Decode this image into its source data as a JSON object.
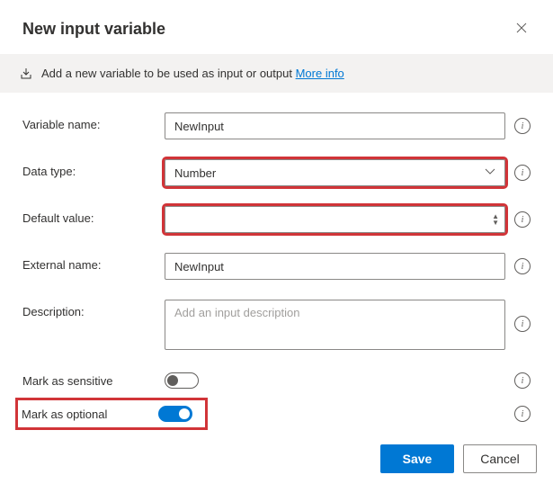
{
  "dialog": {
    "title": "New input variable",
    "banner_text": "Add a new variable to be used as input or output",
    "more_info": "More info"
  },
  "fields": {
    "variable_name": {
      "label": "Variable name:",
      "value": "NewInput"
    },
    "data_type": {
      "label": "Data type:",
      "value": "Number"
    },
    "default_value": {
      "label": "Default value:",
      "value": ""
    },
    "external_name": {
      "label": "External name:",
      "value": "NewInput"
    },
    "description": {
      "label": "Description:",
      "placeholder": "Add an input description",
      "value": ""
    },
    "mark_sensitive": {
      "label": "Mark as sensitive",
      "on": false
    },
    "mark_optional": {
      "label": "Mark as optional",
      "on": true
    }
  },
  "buttons": {
    "save": "Save",
    "cancel": "Cancel"
  }
}
